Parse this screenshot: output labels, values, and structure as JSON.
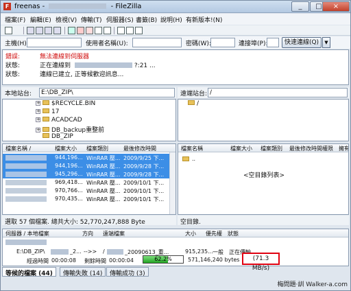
{
  "window": {
    "title": "freenas -",
    "app_name": "- FileZilla",
    "app_icon": "filezilla-icon",
    "controls": [
      "_",
      "□",
      "×"
    ]
  },
  "menu": [
    "檔案(F)",
    "編輯(E)",
    "檢視(V)",
    "傳輸(T)",
    "伺服器(S)",
    "書籤(B)",
    "說明(H)",
    "有新版本!(N)"
  ],
  "quickconnect": {
    "host_label": "主機(H):",
    "user_label": "使用者名稱(U):",
    "pass_label": "密碼(W):",
    "port_label": "連接埠(P):",
    "button": "快速連線(Q)"
  },
  "log": [
    {
      "type": "錯誤:",
      "text": "無法連線到伺服器",
      "color": "#d01010"
    },
    {
      "type": "狀態:",
      "text": "正在連線到",
      "suffix": "?:21 ..."
    },
    {
      "type": "狀態:",
      "text": "連線已建立, 正等候歡迎訊息..."
    }
  ],
  "local": {
    "label": "本地站台:",
    "path": "E:\\DB_ZIP\\",
    "tree": [
      "$RECYCLE.BIN",
      "17",
      "ACADCAD",
      "DB_backup重整前",
      "DB_ZIP"
    ],
    "headers": [
      "檔案名稱 /",
      "檔案大小",
      "檔案類別",
      "最後修改時間"
    ],
    "files": [
      {
        "size": "944,196...",
        "type": "WinRAR 壓...",
        "date": "2009/9/25 下...",
        "selected": true
      },
      {
        "size": "944,196...",
        "type": "WinRAR 壓...",
        "date": "2009/9/28 下...",
        "selected": true
      },
      {
        "size": "945,296...",
        "type": "WinRAR 壓...",
        "date": "2009/9/28 下...",
        "selected": true
      },
      {
        "size": "969,418...",
        "type": "WinRAR 壓...",
        "date": "2009/10/1 下...",
        "selected": false
      },
      {
        "size": "970,766...",
        "type": "WinRAR 壓...",
        "date": "2009/10/1 下...",
        "selected": false
      },
      {
        "size": "970,435...",
        "type": "WinRAR 壓...",
        "date": "2009/10/1 下...",
        "selected": false
      }
    ],
    "status": "選取 57 個檔案. 總共大小: 52,770,247,888 Byte"
  },
  "remote": {
    "label": "遠端站台:",
    "path": "/",
    "tree_root": "/",
    "headers": [
      "檔案名稱",
      "檔案大小",
      "檔案類別",
      "最後修改時間",
      "權限",
      "擁有"
    ],
    "parent_dir": "..",
    "empty_text": "<空目錄列表>",
    "status": "空目錄."
  },
  "queue": {
    "headers": [
      "伺服器 / 本地檔案",
      "方向",
      "遠端檔案",
      "大小",
      "優先權",
      "狀態"
    ],
    "row": {
      "local": "E:\\DB_ZIP\\",
      "local_suffix": "_2...",
      "direction": "-->>",
      "remote": "/",
      "remote_file": "_20090613_重...",
      "size": "915,235...",
      "priority": "一般",
      "status": "正在傳輸"
    },
    "elapsed_label": "經過時間",
    "elapsed": "00:00:08",
    "remaining_label": "剩餘時間",
    "remaining": "00:00:04",
    "progress_percent": 62.2,
    "progress_text": "62.2%",
    "bytes": "571,146,240 bytes",
    "speed": "(71.3 MB/s)"
  },
  "tabs": [
    {
      "label": "等候的檔案 (44)",
      "active": true
    },
    {
      "label": "傳輸失敗 (14)",
      "active": false
    },
    {
      "label": "傳輸成功 (3)",
      "active": false
    }
  ],
  "watermark": "梅問題‧訓 Walker-a.com"
}
